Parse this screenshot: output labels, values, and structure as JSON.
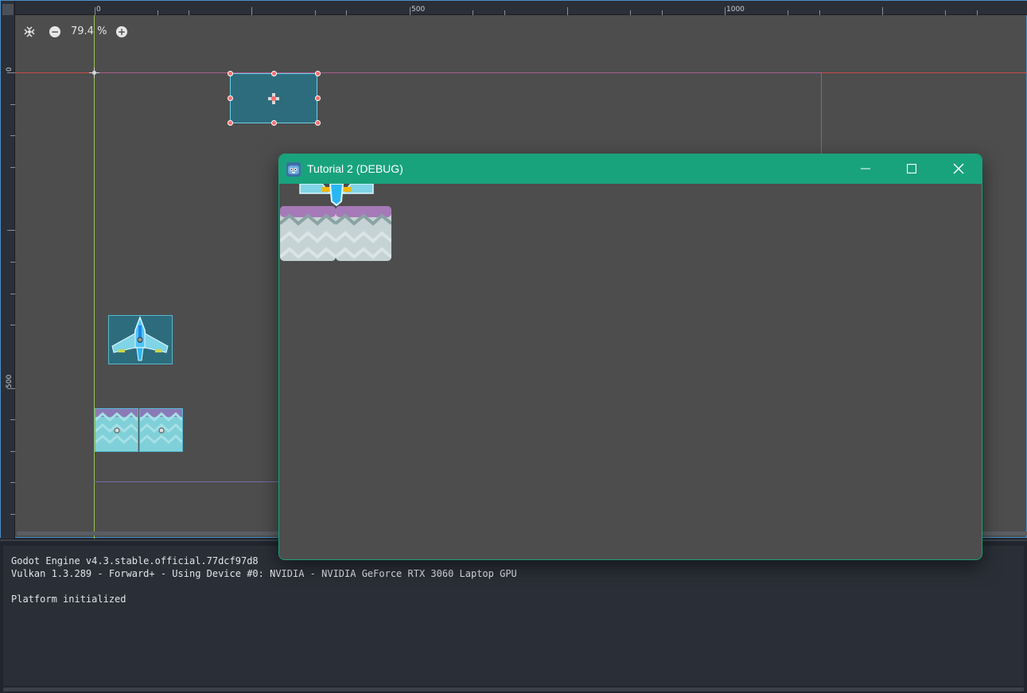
{
  "editor": {
    "ruler": {
      "top_labels": [
        "0",
        "500",
        "1000"
      ],
      "left_labels": [
        "0",
        "500"
      ]
    },
    "zoom": {
      "reset_icon": "center-view-icon",
      "zoom_out_label": "−",
      "zoom_in_label": "+",
      "value": "79.4 %"
    }
  },
  "game_window": {
    "title": "Tutorial 2 (DEBUG)",
    "app_icon": "godot-icon",
    "buttons": {
      "minimize": "—",
      "maximize": "☐",
      "close": "✕"
    }
  },
  "output": {
    "lines": [
      "Godot Engine v4.3.stable.official.77dcf97d8",
      "Vulkan 1.3.289 - Forward+ - Using Device #0: NVIDIA - NVIDIA GeForce RTX 3060 Laptop GPU",
      "",
      "Platform initialized"
    ]
  },
  "colors": {
    "title_bar": "#19a37d",
    "selection_handle": "#ff6b6b",
    "viewport_bg": "#4d4d4d"
  }
}
